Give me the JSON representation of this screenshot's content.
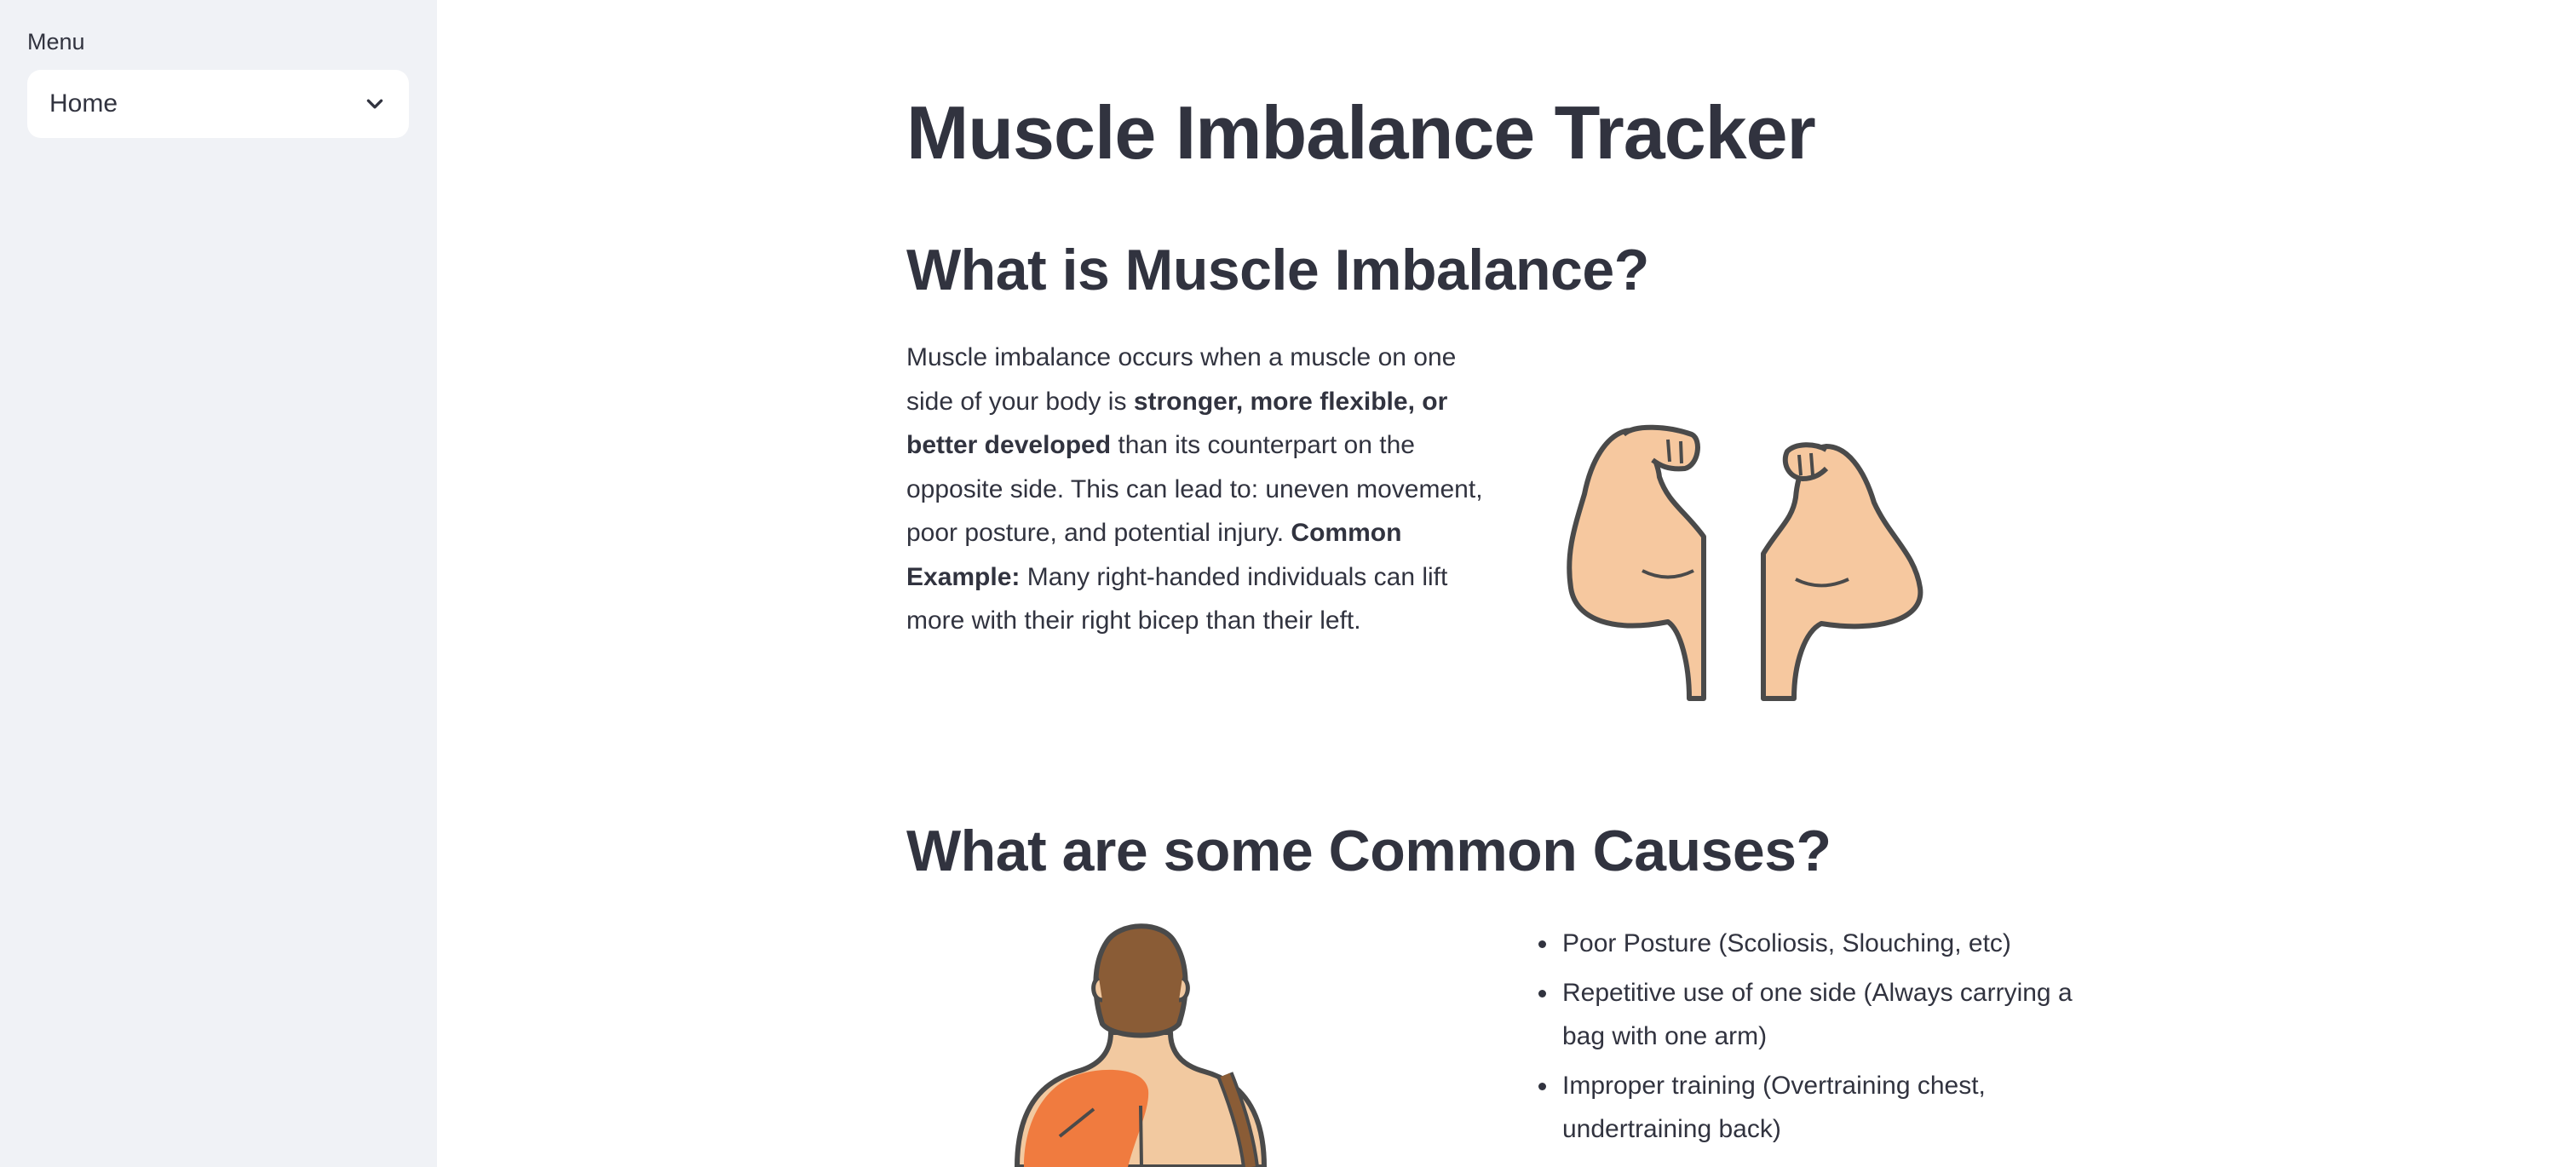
{
  "sidebar": {
    "menu_label": "Menu",
    "select": {
      "value": "Home",
      "icon": "chevron-down-icon"
    }
  },
  "main": {
    "title": "Muscle Imbalance Tracker",
    "what_heading": "What is Muscle Imbalance?",
    "intro": {
      "t1": "Muscle imbalance occurs when a muscle on one side of your body is ",
      "b1": "stronger, more flexible, or better developed",
      "t2": " than its counterpart on the opposite side. This can lead to: uneven movement, poor posture, and potential injury. ",
      "b2": "Common Example:",
      "t3": " Many right-handed individuals can lift more with their right bicep than their left."
    },
    "arms_image": "flexed-biceps-illustration",
    "causes_heading": "What are some Common Causes?",
    "back_image": "person-back-with-shoulder-bag-illustration",
    "causes": [
      "Poor Posture (Scoliosis, Slouching, etc)",
      "Repetitive use of one side (Always carrying a bag with one arm)",
      "Improper training (Overtraining chest, undertraining back)"
    ]
  },
  "colors": {
    "sidebar_bg": "#f0f2f6",
    "text": "#31333f",
    "skin": "#f6c89f",
    "outline": "#4a4a4a",
    "hair": "#8a5c36",
    "strap": "#8a5c36",
    "highlight": "#f07b3f"
  }
}
